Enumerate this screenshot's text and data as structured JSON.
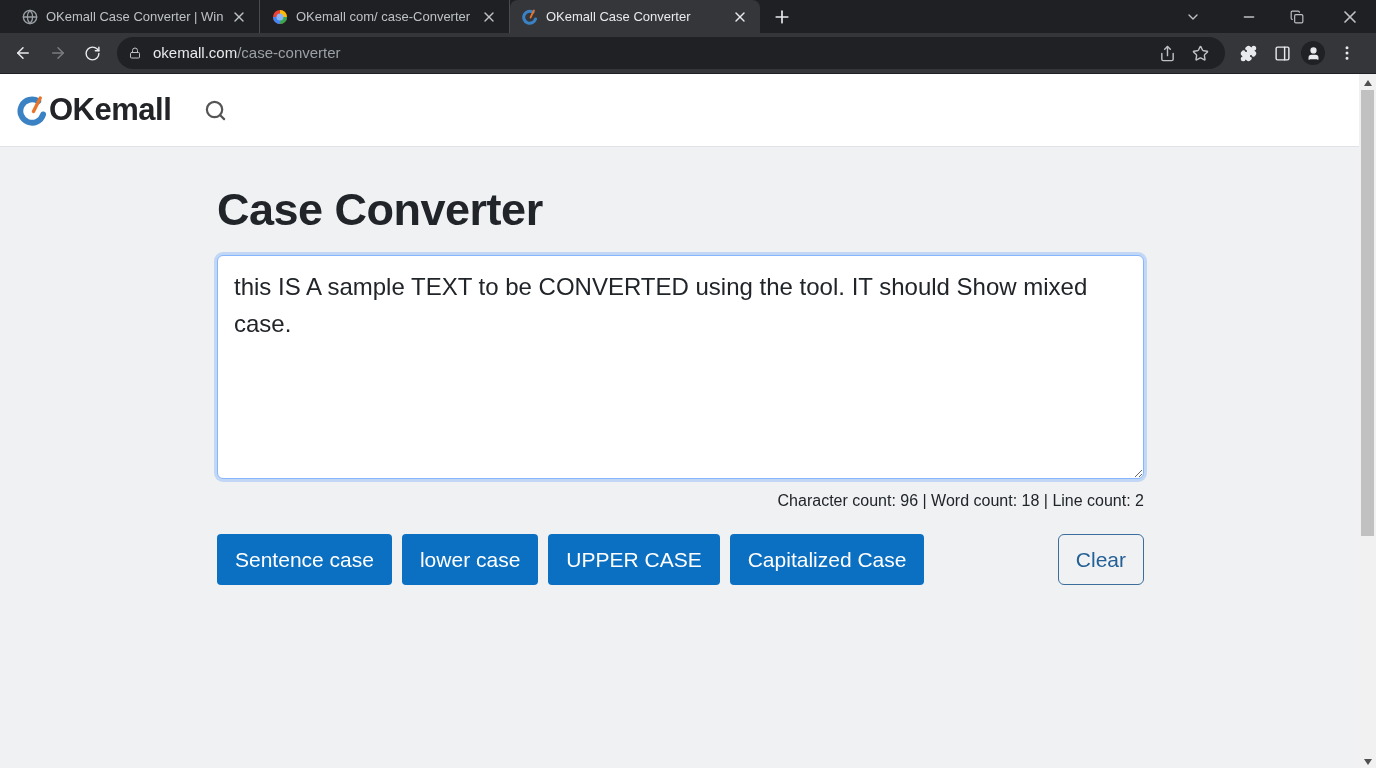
{
  "browser": {
    "tabs": [
      {
        "title": "OKemall Case Converter | Win",
        "kind": "globe",
        "selected": false
      },
      {
        "title": "OKemall com/ case-Converter",
        "kind": "colorful",
        "selected": false
      },
      {
        "title": "OKemall Case Converter",
        "kind": "logo",
        "selected": true
      }
    ],
    "forward_disabled": true,
    "address": {
      "domain": "okemall.com",
      "path": "/case-converter"
    }
  },
  "header": {
    "logo_text": "OKemall"
  },
  "main": {
    "title": "Case Converter",
    "editor": {
      "value": "this IS A sample TEXT to be CONVERTED using the tool. IT should Show mixed case.",
      "focused": true
    },
    "counts": "Character count: 96 | Word count: 18 | Line count: 2",
    "buttons": [
      {
        "label": "Sentence case",
        "kind": "primary"
      },
      {
        "label": "lower case",
        "kind": "primary"
      },
      {
        "label": "UPPER CASE",
        "kind": "primary"
      },
      {
        "label": "Capitalized Case",
        "kind": "primary"
      },
      {
        "label": "Clear",
        "kind": "outline"
      }
    ]
  }
}
